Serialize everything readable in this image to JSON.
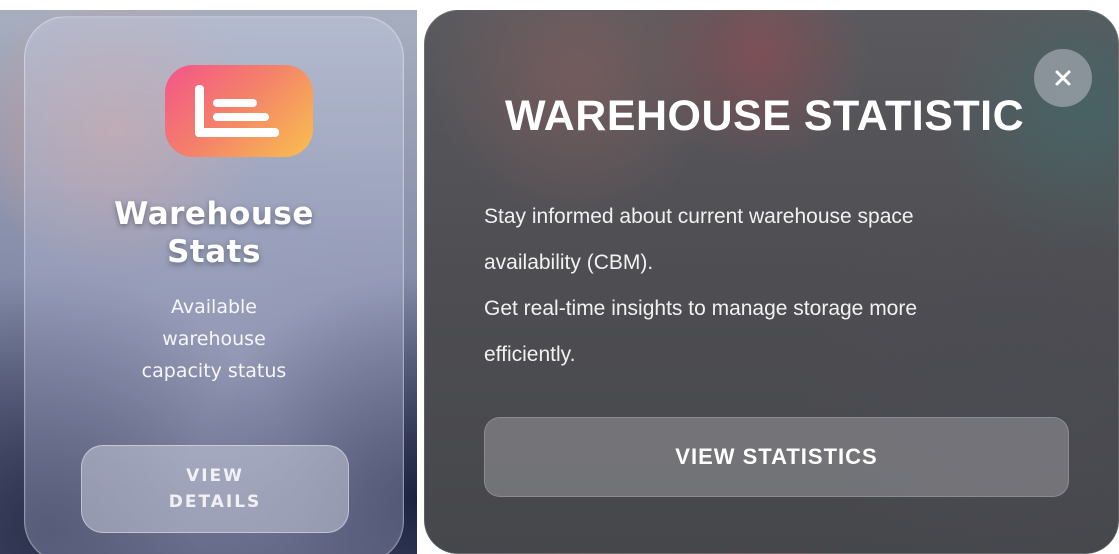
{
  "left_card": {
    "icon": "list-lines-icon",
    "title_line1": "Warehouse",
    "title_line2": "Stats",
    "subtitle_line1": "Available",
    "subtitle_line2": "warehouse",
    "subtitle_line3": "capacity status",
    "button_line1": "VIEW",
    "button_line2": "DETAILS"
  },
  "modal": {
    "close_icon": "close-icon",
    "close_symbol": "×",
    "title": "WAREHOUSE STATISTIC",
    "body_line1": "Stay informed about current warehouse space",
    "body_line2": "availability (CBM).",
    "body_line3": "Get real-time insights to manage storage more",
    "body_line4": "efficiently.",
    "button_label": "VIEW STATISTICS"
  },
  "colors": {
    "icon_gradient_start": "#f3558a",
    "icon_gradient_end": "#f9c04f",
    "text": "#ffffff"
  }
}
